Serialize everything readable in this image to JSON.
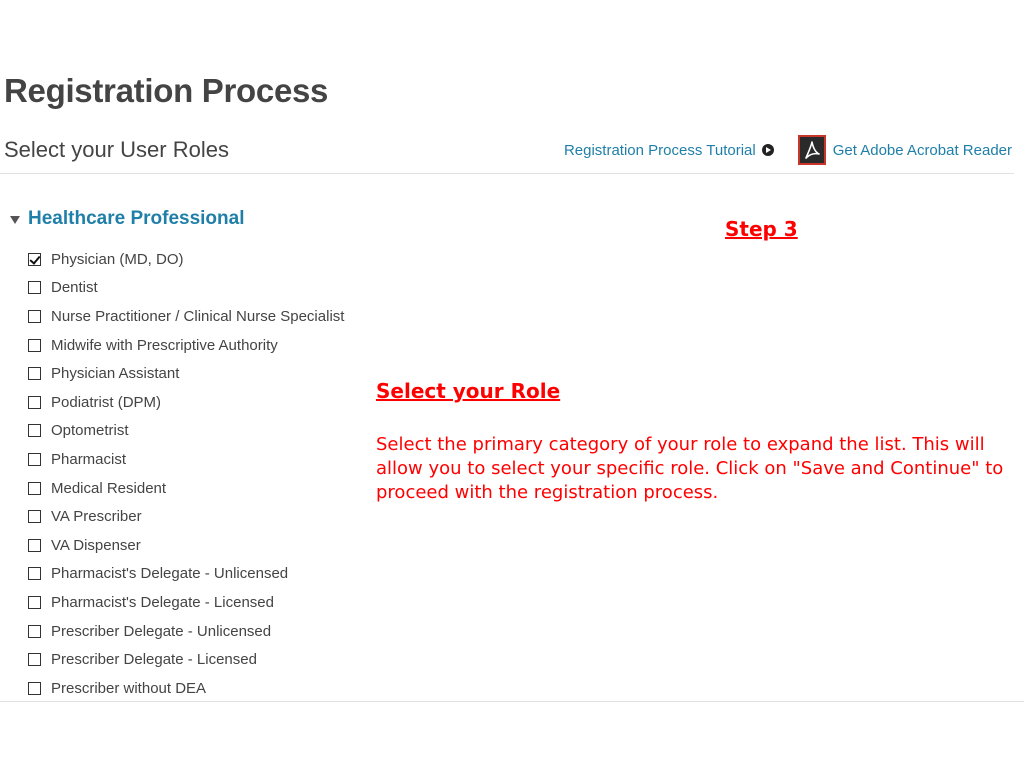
{
  "page": {
    "title": "Registration Process",
    "subtitle": "Select your User Roles"
  },
  "header_links": {
    "tutorial": "Registration Process Tutorial",
    "tutorial_icon": "arrow-circle-right-icon",
    "acrobat": "Get Adobe Acrobat Reader",
    "acrobat_icon": "adobe-acrobat-icon"
  },
  "category": {
    "label": "Healthcare Professional",
    "expanded": true
  },
  "roles": [
    {
      "label": "Physician (MD, DO)",
      "checked": true
    },
    {
      "label": "Dentist",
      "checked": false
    },
    {
      "label": "Nurse Practitioner / Clinical Nurse Specialist",
      "checked": false
    },
    {
      "label": "Midwife with Prescriptive Authority",
      "checked": false
    },
    {
      "label": "Physician Assistant",
      "checked": false
    },
    {
      "label": "Podiatrist (DPM)",
      "checked": false
    },
    {
      "label": "Optometrist",
      "checked": false
    },
    {
      "label": "Pharmacist",
      "checked": false
    },
    {
      "label": "Medical Resident",
      "checked": false
    },
    {
      "label": "VA Prescriber",
      "checked": false
    },
    {
      "label": "VA Dispenser",
      "checked": false
    },
    {
      "label": "Pharmacist's Delegate - Unlicensed",
      "checked": false
    },
    {
      "label": "Pharmacist's Delegate - Licensed",
      "checked": false
    },
    {
      "label": "Prescriber Delegate - Unlicensed",
      "checked": false
    },
    {
      "label": "Prescriber Delegate - Licensed",
      "checked": false
    },
    {
      "label": "Prescriber without DEA",
      "checked": false
    }
  ],
  "annotation": {
    "step": "Step 3",
    "heading": "Select your Role",
    "body": "Select the primary category of your role to expand the list. This will allow you to select your specific role. Click on \"Save and Continue\" to proceed with the registration process."
  },
  "colors": {
    "link": "#1f7fa8",
    "annotation": "#ff0000",
    "title": "#444444"
  }
}
